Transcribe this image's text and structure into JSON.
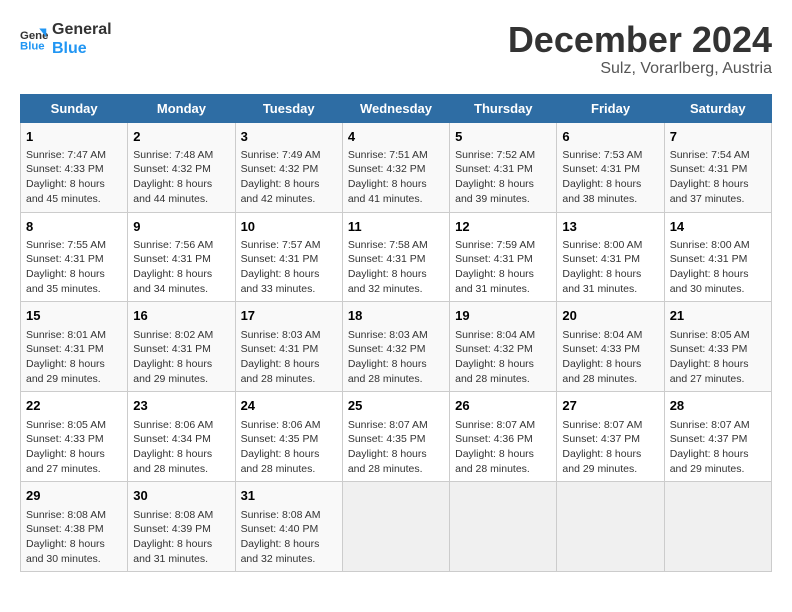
{
  "header": {
    "logo_line1": "General",
    "logo_line2": "Blue",
    "month": "December 2024",
    "location": "Sulz, Vorarlberg, Austria"
  },
  "weekdays": [
    "Sunday",
    "Monday",
    "Tuesday",
    "Wednesday",
    "Thursday",
    "Friday",
    "Saturday"
  ],
  "weeks": [
    [
      {
        "day": "1",
        "info": "Sunrise: 7:47 AM\nSunset: 4:33 PM\nDaylight: 8 hours\nand 45 minutes."
      },
      {
        "day": "2",
        "info": "Sunrise: 7:48 AM\nSunset: 4:32 PM\nDaylight: 8 hours\nand 44 minutes."
      },
      {
        "day": "3",
        "info": "Sunrise: 7:49 AM\nSunset: 4:32 PM\nDaylight: 8 hours\nand 42 minutes."
      },
      {
        "day": "4",
        "info": "Sunrise: 7:51 AM\nSunset: 4:32 PM\nDaylight: 8 hours\nand 41 minutes."
      },
      {
        "day": "5",
        "info": "Sunrise: 7:52 AM\nSunset: 4:31 PM\nDaylight: 8 hours\nand 39 minutes."
      },
      {
        "day": "6",
        "info": "Sunrise: 7:53 AM\nSunset: 4:31 PM\nDaylight: 8 hours\nand 38 minutes."
      },
      {
        "day": "7",
        "info": "Sunrise: 7:54 AM\nSunset: 4:31 PM\nDaylight: 8 hours\nand 37 minutes."
      }
    ],
    [
      {
        "day": "8",
        "info": "Sunrise: 7:55 AM\nSunset: 4:31 PM\nDaylight: 8 hours\nand 35 minutes."
      },
      {
        "day": "9",
        "info": "Sunrise: 7:56 AM\nSunset: 4:31 PM\nDaylight: 8 hours\nand 34 minutes."
      },
      {
        "day": "10",
        "info": "Sunrise: 7:57 AM\nSunset: 4:31 PM\nDaylight: 8 hours\nand 33 minutes."
      },
      {
        "day": "11",
        "info": "Sunrise: 7:58 AM\nSunset: 4:31 PM\nDaylight: 8 hours\nand 32 minutes."
      },
      {
        "day": "12",
        "info": "Sunrise: 7:59 AM\nSunset: 4:31 PM\nDaylight: 8 hours\nand 31 minutes."
      },
      {
        "day": "13",
        "info": "Sunrise: 8:00 AM\nSunset: 4:31 PM\nDaylight: 8 hours\nand 31 minutes."
      },
      {
        "day": "14",
        "info": "Sunrise: 8:00 AM\nSunset: 4:31 PM\nDaylight: 8 hours\nand 30 minutes."
      }
    ],
    [
      {
        "day": "15",
        "info": "Sunrise: 8:01 AM\nSunset: 4:31 PM\nDaylight: 8 hours\nand 29 minutes."
      },
      {
        "day": "16",
        "info": "Sunrise: 8:02 AM\nSunset: 4:31 PM\nDaylight: 8 hours\nand 29 minutes."
      },
      {
        "day": "17",
        "info": "Sunrise: 8:03 AM\nSunset: 4:31 PM\nDaylight: 8 hours\nand 28 minutes."
      },
      {
        "day": "18",
        "info": "Sunrise: 8:03 AM\nSunset: 4:32 PM\nDaylight: 8 hours\nand 28 minutes."
      },
      {
        "day": "19",
        "info": "Sunrise: 8:04 AM\nSunset: 4:32 PM\nDaylight: 8 hours\nand 28 minutes."
      },
      {
        "day": "20",
        "info": "Sunrise: 8:04 AM\nSunset: 4:33 PM\nDaylight: 8 hours\nand 28 minutes."
      },
      {
        "day": "21",
        "info": "Sunrise: 8:05 AM\nSunset: 4:33 PM\nDaylight: 8 hours\nand 27 minutes."
      }
    ],
    [
      {
        "day": "22",
        "info": "Sunrise: 8:05 AM\nSunset: 4:33 PM\nDaylight: 8 hours\nand 27 minutes."
      },
      {
        "day": "23",
        "info": "Sunrise: 8:06 AM\nSunset: 4:34 PM\nDaylight: 8 hours\nand 28 minutes."
      },
      {
        "day": "24",
        "info": "Sunrise: 8:06 AM\nSunset: 4:35 PM\nDaylight: 8 hours\nand 28 minutes."
      },
      {
        "day": "25",
        "info": "Sunrise: 8:07 AM\nSunset: 4:35 PM\nDaylight: 8 hours\nand 28 minutes."
      },
      {
        "day": "26",
        "info": "Sunrise: 8:07 AM\nSunset: 4:36 PM\nDaylight: 8 hours\nand 28 minutes."
      },
      {
        "day": "27",
        "info": "Sunrise: 8:07 AM\nSunset: 4:37 PM\nDaylight: 8 hours\nand 29 minutes."
      },
      {
        "day": "28",
        "info": "Sunrise: 8:07 AM\nSunset: 4:37 PM\nDaylight: 8 hours\nand 29 minutes."
      }
    ],
    [
      {
        "day": "29",
        "info": "Sunrise: 8:08 AM\nSunset: 4:38 PM\nDaylight: 8 hours\nand 30 minutes."
      },
      {
        "day": "30",
        "info": "Sunrise: 8:08 AM\nSunset: 4:39 PM\nDaylight: 8 hours\nand 31 minutes."
      },
      {
        "day": "31",
        "info": "Sunrise: 8:08 AM\nSunset: 4:40 PM\nDaylight: 8 hours\nand 32 minutes."
      },
      null,
      null,
      null,
      null
    ]
  ]
}
